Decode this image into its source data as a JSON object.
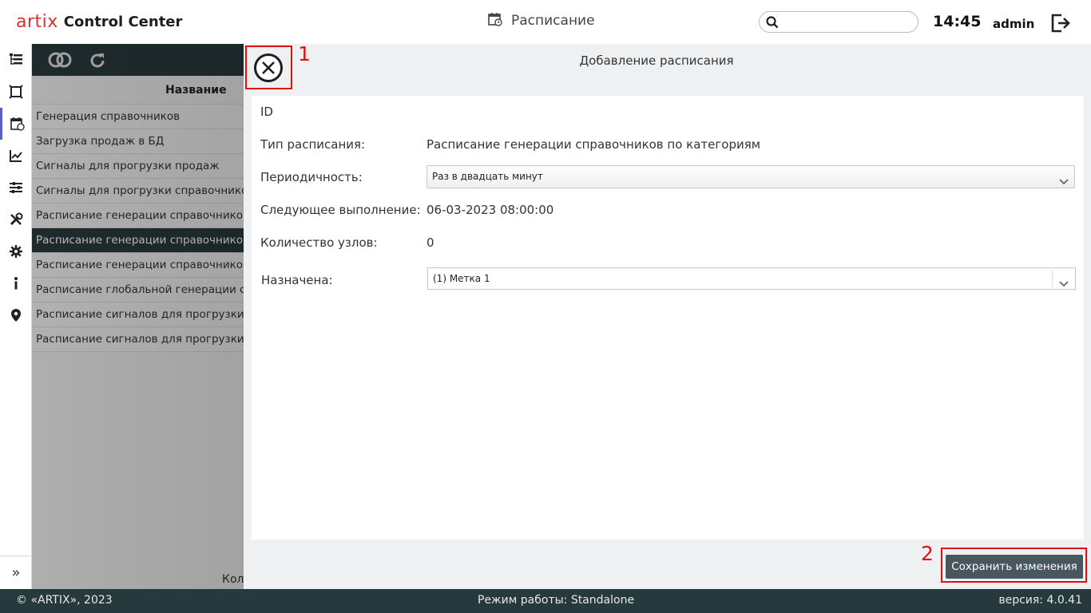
{
  "header": {
    "logo_text": "artix",
    "app_name": "Control Center",
    "page_title": "Расписание",
    "search_placeholder": "",
    "time": "14:45",
    "user": "admin"
  },
  "rail": {
    "icons": [
      "tree-icon",
      "frame-icon",
      "calendar-icon",
      "chart-icon",
      "sliders-icon",
      "tools-icon",
      "gear-icon",
      "info-icon",
      "location-icon"
    ],
    "active_index": 2,
    "accent_color": "#5b5fc7",
    "expand_label": "»"
  },
  "list": {
    "column_header": "Название",
    "rows": [
      "Генерация справочников",
      "Загрузка продаж в БД",
      "Сигналы для прогрузки продаж",
      "Сигналы для прогрузки справочников",
      "Расписание генерации справочников для",
      "Расписание генерации справочников по",
      "Расписание генерации справочников по",
      "Расписание глобальной генерации справ",
      "Расписание сигналов для прогрузки про",
      "Расписание сигналов для прогрузки спр"
    ],
    "selected_index": 5,
    "footer_text": "Кол"
  },
  "dialog": {
    "title": "Добавление расписания",
    "annotation_1": "1",
    "annotation_2": "2",
    "fields": {
      "id_label": "ID",
      "type_label": "Тип расписания:",
      "type_value": "Расписание генерации справочников по категориям",
      "period_label": "Периодичность:",
      "period_value": "Раз в двадцать минут",
      "next_label": "Следующее выполнение:",
      "next_value": "06-03-2023 08:00:00",
      "nodes_label": "Количество узлов:",
      "nodes_value": "0",
      "assigned_label": "Назначена:",
      "assigned_value": "(1) Метка 1"
    },
    "save_label": "Сохранить изменения"
  },
  "footer": {
    "copyright": "© «ARTIX», 2023",
    "mode": "Режим работы: Standalone",
    "version": "версия: 4.0.41"
  },
  "colors": {
    "brand_red": "#d9312b",
    "dark_panel": "#293a3d",
    "annotation_red": "#e01010",
    "save_button": "#48565e"
  }
}
